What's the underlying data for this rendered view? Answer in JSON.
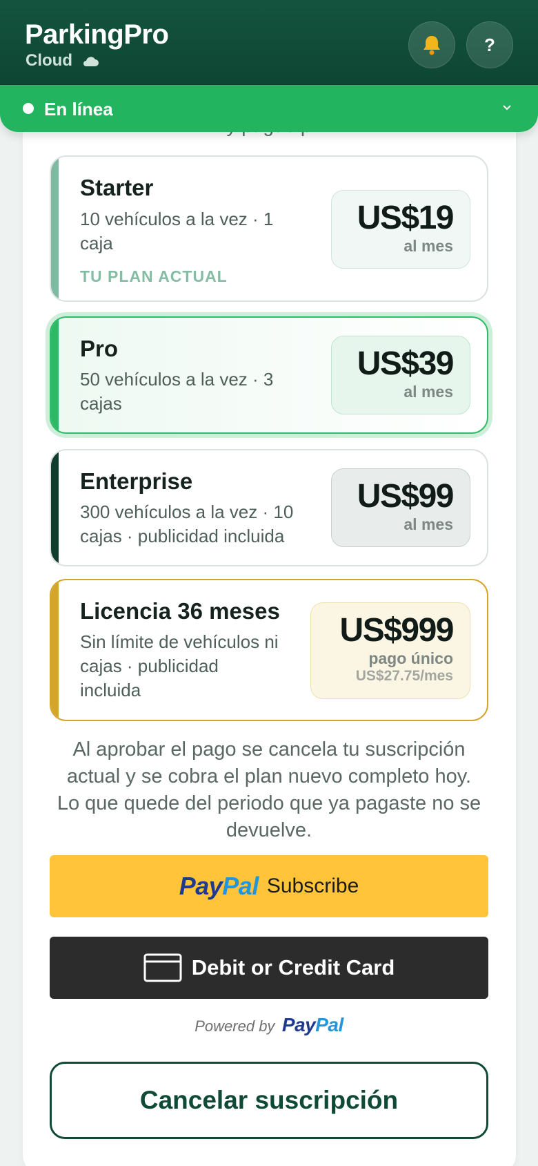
{
  "header": {
    "brand": "ParkingPro",
    "subtitle": "Cloud",
    "help_label": "?"
  },
  "status": {
    "label": "En línea",
    "chevron": "v"
  },
  "content": {
    "peek_text": "y pague p"
  },
  "plans": [
    {
      "name": "Starter",
      "description": "10 vehículos a la vez · 1 caja",
      "tag": "TU PLAN ACTUAL",
      "price": "US$19",
      "period": "al mes"
    },
    {
      "name": "Pro",
      "description": "50 vehículos a la vez · 3 cajas",
      "price": "US$39",
      "period": "al mes"
    },
    {
      "name": "Enterprise",
      "description": "300 vehículos a la vez · 10 cajas · publicidad incluida",
      "price": "US$99",
      "period": "al mes"
    },
    {
      "name": "Licencia 36 meses",
      "description": "Sin límite de vehículos ni cajas · publicidad incluida",
      "price": "US$999",
      "period": "pago único",
      "sub": "US$27.75/mes"
    }
  ],
  "notice": "Al aprobar el pago se cancela tu suscripción actual y se cobra el plan nuevo completo hoy. Lo que quede del periodo que ya pagaste no se devuelve.",
  "paypal": {
    "logo_pay": "Pay",
    "logo_pal": "Pal",
    "subscribe_label": "Subscribe",
    "card_label": "Debit or Credit Card",
    "powered_by": "Powered by"
  },
  "cancel_label": "Cancelar suscripción",
  "colors": {
    "header": "#14543f",
    "online": "#22b45f",
    "paypal_yellow": "#ffc43a",
    "card_black": "#2c2c2c",
    "gold": "#d4a52b"
  },
  "icons": {
    "notifications": "bell-icon",
    "help": "question-icon",
    "cloud": "cloud-icon",
    "card": "credit-card-icon"
  }
}
